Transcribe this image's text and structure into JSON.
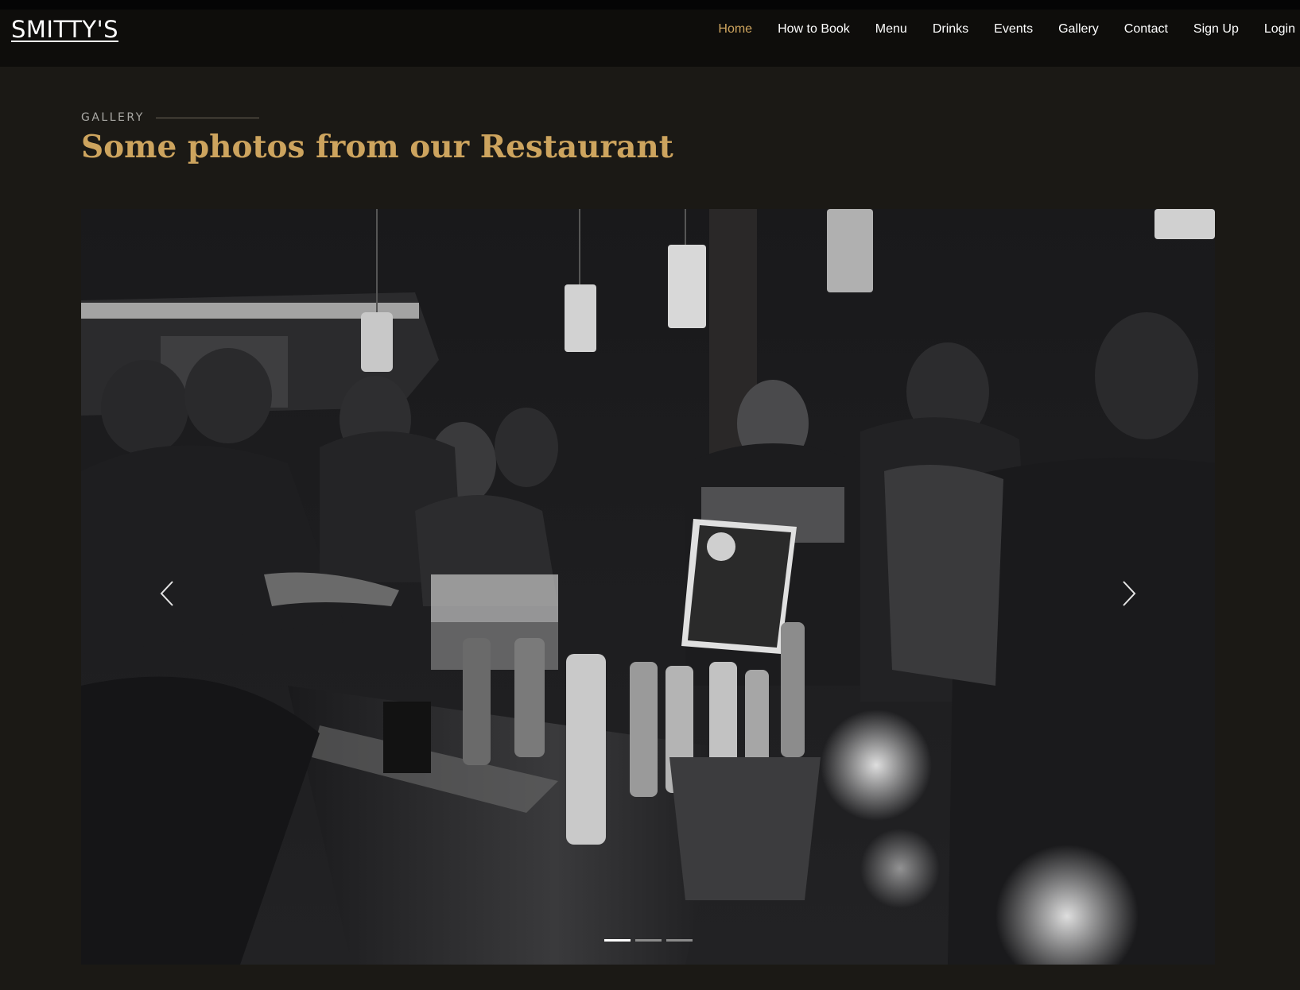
{
  "brand": {
    "logo_text": "SMITTY'S"
  },
  "nav": {
    "items": [
      {
        "label": "Home",
        "active": true
      },
      {
        "label": "How to Book",
        "active": false
      },
      {
        "label": "Menu",
        "active": false
      },
      {
        "label": "Drinks",
        "active": false
      },
      {
        "label": "Events",
        "active": false
      },
      {
        "label": "Gallery",
        "active": false
      },
      {
        "label": "Contact",
        "active": false
      },
      {
        "label": "Sign Up",
        "active": false
      },
      {
        "label": "Login",
        "active": false
      }
    ]
  },
  "gallery": {
    "section_label": "GALLERY",
    "heading": "Some photos from our Restaurant",
    "carousel": {
      "slide_count": 3,
      "active_slide": 1,
      "prev_icon": "chevron-left-icon",
      "next_icon": "chevron-right-icon"
    }
  },
  "colors": {
    "page_bg": "#1b1915",
    "nav_bg": "#0e0d0b",
    "accent": "#cda45e",
    "label_gray": "#aaa9a5"
  }
}
